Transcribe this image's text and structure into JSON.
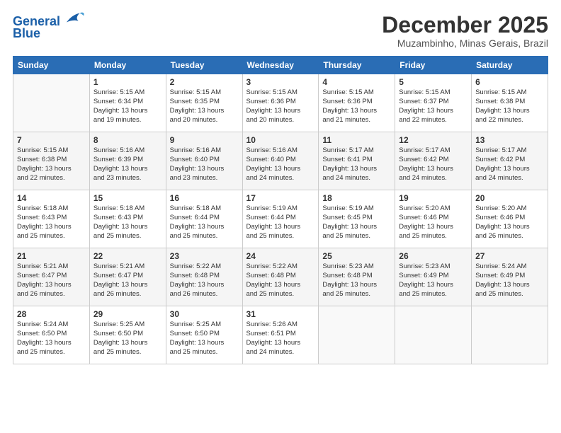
{
  "header": {
    "logo_line1": "General",
    "logo_line2": "Blue",
    "month": "December 2025",
    "location": "Muzambinho, Minas Gerais, Brazil"
  },
  "weekdays": [
    "Sunday",
    "Monday",
    "Tuesday",
    "Wednesday",
    "Thursday",
    "Friday",
    "Saturday"
  ],
  "weeks": [
    [
      {
        "day": "",
        "info": ""
      },
      {
        "day": "1",
        "info": "Sunrise: 5:15 AM\nSunset: 6:34 PM\nDaylight: 13 hours\nand 19 minutes."
      },
      {
        "day": "2",
        "info": "Sunrise: 5:15 AM\nSunset: 6:35 PM\nDaylight: 13 hours\nand 20 minutes."
      },
      {
        "day": "3",
        "info": "Sunrise: 5:15 AM\nSunset: 6:36 PM\nDaylight: 13 hours\nand 20 minutes."
      },
      {
        "day": "4",
        "info": "Sunrise: 5:15 AM\nSunset: 6:36 PM\nDaylight: 13 hours\nand 21 minutes."
      },
      {
        "day": "5",
        "info": "Sunrise: 5:15 AM\nSunset: 6:37 PM\nDaylight: 13 hours\nand 22 minutes."
      },
      {
        "day": "6",
        "info": "Sunrise: 5:15 AM\nSunset: 6:38 PM\nDaylight: 13 hours\nand 22 minutes."
      }
    ],
    [
      {
        "day": "7",
        "info": "Sunrise: 5:15 AM\nSunset: 6:38 PM\nDaylight: 13 hours\nand 22 minutes."
      },
      {
        "day": "8",
        "info": "Sunrise: 5:16 AM\nSunset: 6:39 PM\nDaylight: 13 hours\nand 23 minutes."
      },
      {
        "day": "9",
        "info": "Sunrise: 5:16 AM\nSunset: 6:40 PM\nDaylight: 13 hours\nand 23 minutes."
      },
      {
        "day": "10",
        "info": "Sunrise: 5:16 AM\nSunset: 6:40 PM\nDaylight: 13 hours\nand 24 minutes."
      },
      {
        "day": "11",
        "info": "Sunrise: 5:17 AM\nSunset: 6:41 PM\nDaylight: 13 hours\nand 24 minutes."
      },
      {
        "day": "12",
        "info": "Sunrise: 5:17 AM\nSunset: 6:42 PM\nDaylight: 13 hours\nand 24 minutes."
      },
      {
        "day": "13",
        "info": "Sunrise: 5:17 AM\nSunset: 6:42 PM\nDaylight: 13 hours\nand 24 minutes."
      }
    ],
    [
      {
        "day": "14",
        "info": "Sunrise: 5:18 AM\nSunset: 6:43 PM\nDaylight: 13 hours\nand 25 minutes."
      },
      {
        "day": "15",
        "info": "Sunrise: 5:18 AM\nSunset: 6:43 PM\nDaylight: 13 hours\nand 25 minutes."
      },
      {
        "day": "16",
        "info": "Sunrise: 5:18 AM\nSunset: 6:44 PM\nDaylight: 13 hours\nand 25 minutes."
      },
      {
        "day": "17",
        "info": "Sunrise: 5:19 AM\nSunset: 6:44 PM\nDaylight: 13 hours\nand 25 minutes."
      },
      {
        "day": "18",
        "info": "Sunrise: 5:19 AM\nSunset: 6:45 PM\nDaylight: 13 hours\nand 25 minutes."
      },
      {
        "day": "19",
        "info": "Sunrise: 5:20 AM\nSunset: 6:46 PM\nDaylight: 13 hours\nand 25 minutes."
      },
      {
        "day": "20",
        "info": "Sunrise: 5:20 AM\nSunset: 6:46 PM\nDaylight: 13 hours\nand 26 minutes."
      }
    ],
    [
      {
        "day": "21",
        "info": "Sunrise: 5:21 AM\nSunset: 6:47 PM\nDaylight: 13 hours\nand 26 minutes."
      },
      {
        "day": "22",
        "info": "Sunrise: 5:21 AM\nSunset: 6:47 PM\nDaylight: 13 hours\nand 26 minutes."
      },
      {
        "day": "23",
        "info": "Sunrise: 5:22 AM\nSunset: 6:48 PM\nDaylight: 13 hours\nand 26 minutes."
      },
      {
        "day": "24",
        "info": "Sunrise: 5:22 AM\nSunset: 6:48 PM\nDaylight: 13 hours\nand 25 minutes."
      },
      {
        "day": "25",
        "info": "Sunrise: 5:23 AM\nSunset: 6:48 PM\nDaylight: 13 hours\nand 25 minutes."
      },
      {
        "day": "26",
        "info": "Sunrise: 5:23 AM\nSunset: 6:49 PM\nDaylight: 13 hours\nand 25 minutes."
      },
      {
        "day": "27",
        "info": "Sunrise: 5:24 AM\nSunset: 6:49 PM\nDaylight: 13 hours\nand 25 minutes."
      }
    ],
    [
      {
        "day": "28",
        "info": "Sunrise: 5:24 AM\nSunset: 6:50 PM\nDaylight: 13 hours\nand 25 minutes."
      },
      {
        "day": "29",
        "info": "Sunrise: 5:25 AM\nSunset: 6:50 PM\nDaylight: 13 hours\nand 25 minutes."
      },
      {
        "day": "30",
        "info": "Sunrise: 5:25 AM\nSunset: 6:50 PM\nDaylight: 13 hours\nand 25 minutes."
      },
      {
        "day": "31",
        "info": "Sunrise: 5:26 AM\nSunset: 6:51 PM\nDaylight: 13 hours\nand 24 minutes."
      },
      {
        "day": "",
        "info": ""
      },
      {
        "day": "",
        "info": ""
      },
      {
        "day": "",
        "info": ""
      }
    ]
  ]
}
